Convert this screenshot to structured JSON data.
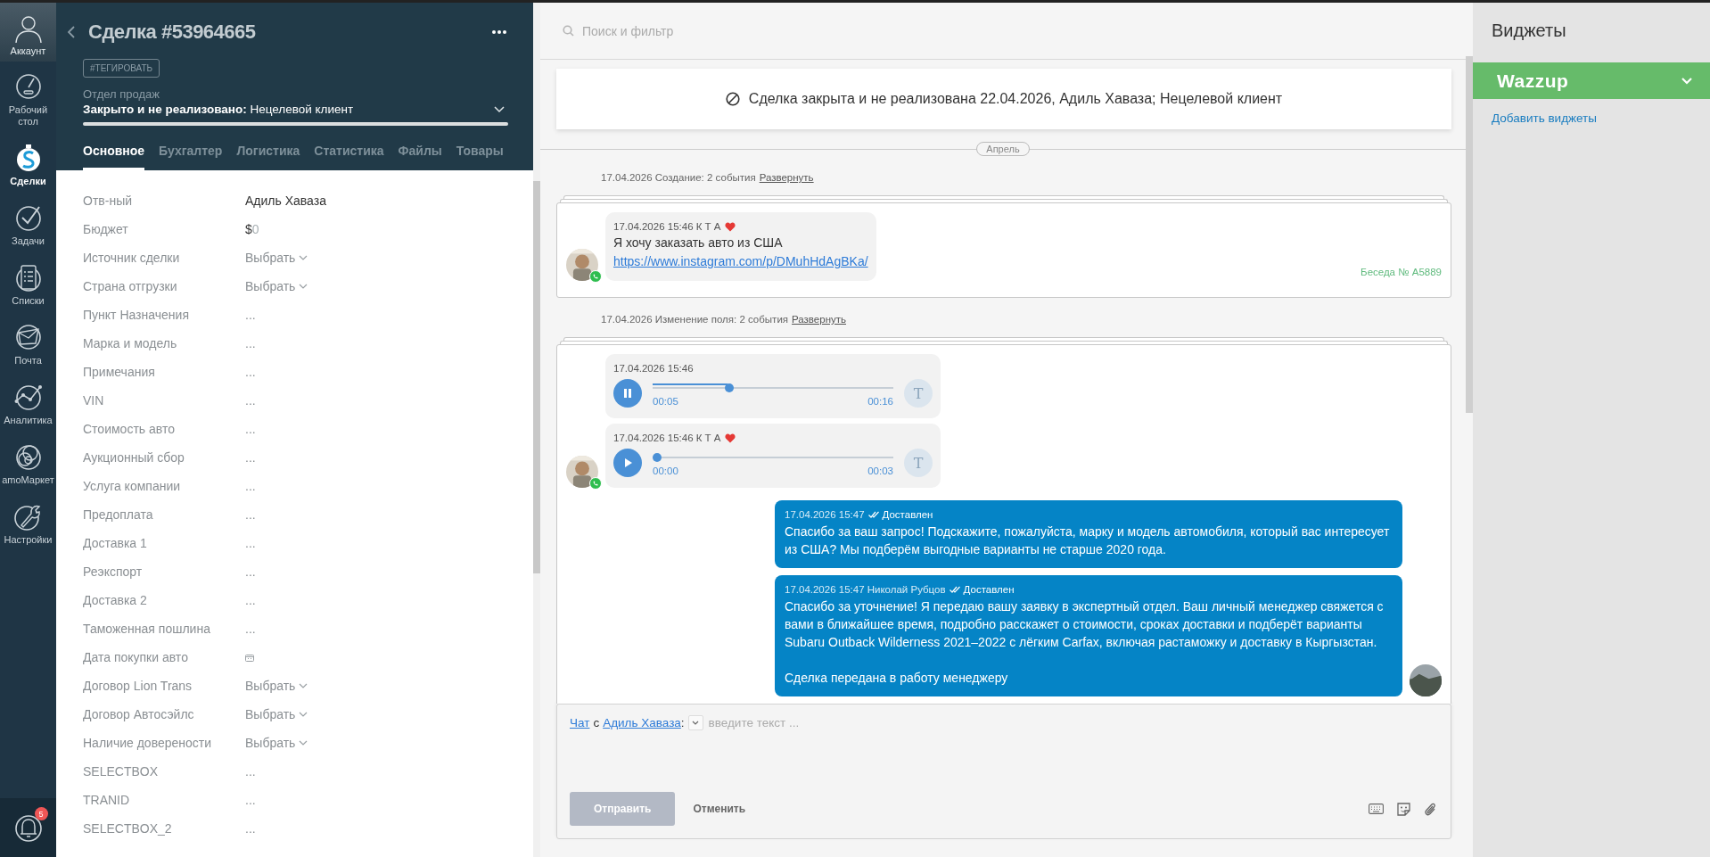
{
  "nav": {
    "account": {
      "label": "Аккаунт"
    },
    "items": [
      {
        "label": "Рабочий стол",
        "selected": false
      },
      {
        "label": "Сделки",
        "selected": true
      },
      {
        "label": "Задачи",
        "selected": false
      },
      {
        "label": "Списки",
        "selected": false
      },
      {
        "label": "Почта",
        "selected": false
      },
      {
        "label": "Аналитика",
        "selected": false
      },
      {
        "label": "amoМаркет",
        "selected": false
      },
      {
        "label": "Настройки",
        "selected": false
      }
    ],
    "notifications": {
      "badge": "5"
    }
  },
  "deal": {
    "title": "Сделка #53964665",
    "tag_button": "#ТЕГИРОВАТЬ",
    "pipeline": "Отдел продаж",
    "status_label": "Закрыто и не реализовано:",
    "status_value": "Нецелевой клиент",
    "tabs": [
      {
        "label": "Основное",
        "selected": true
      },
      {
        "label": "Бухгалтер",
        "selected": false
      },
      {
        "label": "Логистика",
        "selected": false
      },
      {
        "label": "Статистика",
        "selected": false
      },
      {
        "label": "Файлы",
        "selected": false
      },
      {
        "label": "Товары",
        "selected": false
      }
    ],
    "fields": [
      {
        "label": "Отв-ный",
        "kind": "text",
        "value": "Адиль Хаваза"
      },
      {
        "label": "Бюджет",
        "kind": "money",
        "currency": "$",
        "value": "0"
      },
      {
        "label": "Источник сделки",
        "kind": "select",
        "placeholder": "Выбрать"
      },
      {
        "label": "Страна отгрузки",
        "kind": "select",
        "placeholder": "Выбрать"
      },
      {
        "label": "Пункт Назначения",
        "kind": "empty",
        "value": "..."
      },
      {
        "label": "Марка и модель",
        "kind": "empty",
        "value": "..."
      },
      {
        "label": "Примечания",
        "kind": "empty",
        "value": "..."
      },
      {
        "label": "VIN",
        "kind": "empty",
        "value": "..."
      },
      {
        "label": "Стоимость авто",
        "kind": "empty",
        "value": "..."
      },
      {
        "label": "Аукционный сбор",
        "kind": "empty",
        "value": "..."
      },
      {
        "label": "Услуга компании",
        "kind": "empty",
        "value": "..."
      },
      {
        "label": "Предоплата",
        "kind": "empty",
        "value": "..."
      },
      {
        "label": "Доставка 1",
        "kind": "empty",
        "value": "..."
      },
      {
        "label": "Реэкспорт",
        "kind": "empty",
        "value": "..."
      },
      {
        "label": "Доставка 2",
        "kind": "empty",
        "value": "..."
      },
      {
        "label": "Таможенная пошлина",
        "kind": "empty",
        "value": "..."
      },
      {
        "label": "Дата покупки авто",
        "kind": "date"
      },
      {
        "label": "Договор Lion Trans",
        "kind": "select",
        "placeholder": "Выбрать"
      },
      {
        "label": "Договор Автосэйлс",
        "kind": "select",
        "placeholder": "Выбрать"
      },
      {
        "label": "Наличие довереноcти",
        "kind": "select",
        "placeholder": "Выбрать"
      },
      {
        "label": "SELECTBOX",
        "kind": "empty",
        "value": "..."
      },
      {
        "label": "TRANID",
        "kind": "empty",
        "value": "..."
      },
      {
        "label": "SELECTBOX_2",
        "kind": "empty",
        "value": "..."
      }
    ]
  },
  "feed": {
    "search": {
      "placeholder": "Поиск и фильтр"
    },
    "banner": "Сделка закрыта и не реализована 22.04.2026, Адиль Хаваза; Нецелевой клиент",
    "month": "Апрель",
    "entries": [
      {
        "kind": "summary",
        "text": "17.04.2026 Создание: 2 события",
        "link": "Развернуть"
      },
      {
        "kind": "group",
        "conversation": "Беседа № A5889",
        "messages": [
          {
            "kind": "text",
            "meta": "17.04.2026 15:46 К Т А",
            "liked": true,
            "text": "Я хочу заказать авто из США",
            "link": "https://www.instagram.com/p/DMuhHdAgBKa/"
          }
        ]
      },
      {
        "kind": "summary",
        "text": "17.04.2026 Изменение поля: 2 события",
        "link": "Развернуть"
      },
      {
        "kind": "group",
        "messages": [
          {
            "kind": "audio",
            "meta": "17.04.2026 15:46",
            "liked": false,
            "playing": true,
            "level": 0.31,
            "elapsed": "00:05",
            "duration": "00:16",
            "transcribe": "T"
          },
          {
            "kind": "audio",
            "meta": "17.04.2026 15:46 К Т А",
            "liked": true,
            "playing": false,
            "level": 0,
            "elapsed": "00:00",
            "duration": "00:03",
            "transcribe": "T"
          },
          {
            "kind": "outgoing",
            "meta": "17.04.2026 15:47",
            "status": "Доставлен",
            "paragraphs": [
              "Спасибо за ваш запрос! Подскажите, пожалуйста, марку и модель автомобиля, который вас интересует из США? Мы подберём выгодные варианты не старше 2020 года."
            ]
          },
          {
            "kind": "outgoing",
            "meta": "17.04.2026 15:47 Николай Рубцов",
            "status": "Доставлен",
            "paragraphs": [
              "Спасибо за уточнение! Я передаю вашу заявку в экспертный отдел. Ваш личный менеджер свяжется с вами в ближайшее время, подробно расскажет о стоимости, сроках доставки и подберёт варианты Subaru Outback Wilderness 2021–2022 с лёгким Carfax, включая растаможку и доставку в Кыргызстан.",
              "Сделка передана в работу менеджеру"
            ]
          }
        ]
      }
    ],
    "composer": {
      "chat_link": "Чат",
      "with": "с",
      "contact": "Адиль Хаваза",
      "colon": ":",
      "placeholder": "введите текст ...",
      "send": {
        "label": "Отправить",
        "disabled": true
      },
      "cancel": "Отменить"
    }
  },
  "widgets": {
    "title": "Виджеты",
    "items": [
      {
        "name": "Wazzup",
        "color": "#66bb6a"
      }
    ],
    "add_link": "Добавить виджеты"
  }
}
